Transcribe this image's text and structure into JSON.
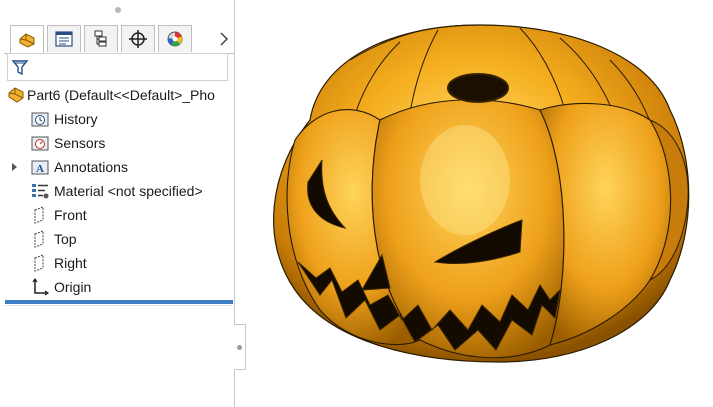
{
  "part_node": {
    "label": "Part6  (Default<<Default>_Pho"
  },
  "tree": {
    "items": [
      {
        "label": "History",
        "icon": "history-icon"
      },
      {
        "label": "Sensors",
        "icon": "sensors-icon"
      },
      {
        "label": "Annotations",
        "icon": "annotations-icon",
        "expandable": true
      },
      {
        "label": "Material <not specified>",
        "icon": "material-icon"
      },
      {
        "label": "Front",
        "icon": "plane-icon"
      },
      {
        "label": "Top",
        "icon": "plane-icon"
      },
      {
        "label": "Right",
        "icon": "plane-icon"
      },
      {
        "label": "Origin",
        "icon": "origin-icon"
      }
    ]
  },
  "tabs": [
    {
      "name": "feature-manager",
      "icon": "feature-manager-icon",
      "active": true
    },
    {
      "name": "property-manager",
      "icon": "property-manager-icon"
    },
    {
      "name": "configuration-manager",
      "icon": "configuration-manager-icon"
    },
    {
      "name": "dimxpert-manager",
      "icon": "crosshair-icon"
    },
    {
      "name": "display-manager",
      "icon": "appearance-icon"
    }
  ],
  "colors": {
    "rollback_bar": "#3d7ec2",
    "pumpkin_orange": "#f0a020",
    "pumpkin_dark": "#b86e08"
  },
  "viewport": {
    "model": "pumpkin"
  }
}
